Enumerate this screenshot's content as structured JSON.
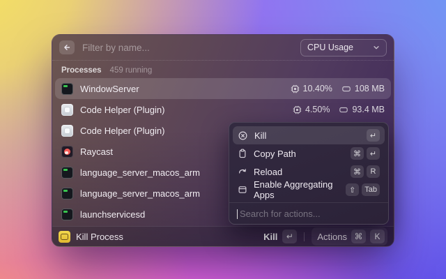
{
  "window": {
    "filter_placeholder": "Filter by name...",
    "dropdown_value": "CPU Usage",
    "section": {
      "title": "Processes",
      "count": "459 running"
    },
    "processes": [
      {
        "name": "WindowServer",
        "icon": "terminal-icon",
        "cpu": "10.40%",
        "mem": "108 MB",
        "selected": true
      },
      {
        "name": "Code Helper (Plugin)",
        "icon": "app-light-icon",
        "cpu": "4.50%",
        "mem": "93.4 MB",
        "selected": false
      },
      {
        "name": "Code Helper (Plugin)",
        "icon": "app-light-icon",
        "selected": false
      },
      {
        "name": "Raycast",
        "icon": "raycast-icon",
        "selected": false
      },
      {
        "name": "language_server_macos_arm",
        "icon": "terminal-icon",
        "selected": false
      },
      {
        "name": "language_server_macos_arm",
        "icon": "terminal-icon",
        "selected": false
      },
      {
        "name": "launchservicesd",
        "icon": "terminal-icon",
        "selected": false
      }
    ]
  },
  "action_panel": {
    "items": [
      {
        "label": "Kill",
        "icon": "kill-circle-x-icon",
        "keys": [
          "↵"
        ],
        "selected": true
      },
      {
        "label": "Copy Path",
        "icon": "clipboard-icon",
        "keys": [
          "⌘",
          "↵"
        ],
        "selected": false
      },
      {
        "label": "Reload",
        "icon": "reload-arrow-icon",
        "keys": [
          "⌘",
          "R"
        ],
        "selected": false
      },
      {
        "label": "Enable Aggregating Apps",
        "icon": "app-window-icon",
        "keys": [
          "⇧",
          "Tab"
        ],
        "selected": false
      }
    ],
    "search_placeholder": "Search for actions..."
  },
  "footer": {
    "app_label": "Kill Process",
    "primary_action": "Kill",
    "primary_key": "↵",
    "actions_label": "Actions",
    "actions_keys": [
      "⌘",
      "K"
    ]
  },
  "colors": {
    "accent_yellow": "#e9c83f",
    "terminal_green": "#39c44f",
    "raycast_red": "#f55a56",
    "selection": "rgba(255,255,255,0.13)"
  }
}
